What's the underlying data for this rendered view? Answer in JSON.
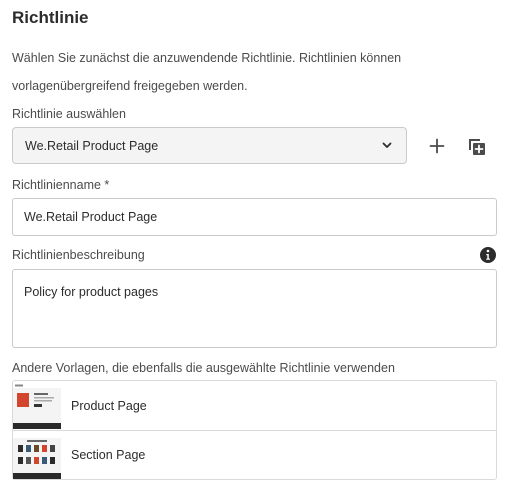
{
  "heading": "Richtlinie",
  "description": "Wählen Sie zunächst die anzuwendende Richtlinie. Richtlinien können vorlagenübergreifend freigegeben werden.",
  "policy_select": {
    "label": "Richtlinie auswählen",
    "value": "We.Retail Product Page",
    "icon": "chevron-down-icon"
  },
  "actions": {
    "add_icon": "plus-icon",
    "duplicate_icon": "duplicate-icon"
  },
  "policy_name": {
    "label": "Richtlinienname *",
    "value": "We.Retail Product Page"
  },
  "policy_description": {
    "label": "Richtlinienbeschreibung",
    "value": "Policy for product pages",
    "info_icon": "info-icon"
  },
  "templates": {
    "label": "Andere Vorlagen, die ebenfalls die ausgewählte Richtlinie verwenden",
    "items": [
      {
        "name": "Product Page",
        "thumbnail": "product-page-thumbnail"
      },
      {
        "name": "Section Page",
        "thumbnail": "section-page-thumbnail"
      }
    ]
  }
}
